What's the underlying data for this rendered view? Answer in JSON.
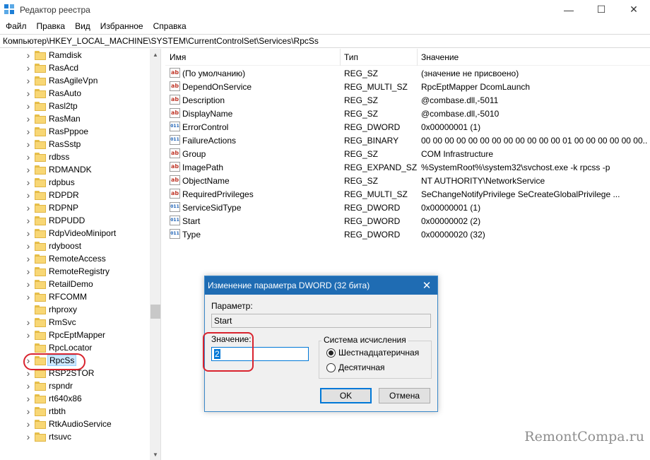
{
  "window": {
    "title": "Редактор реестра",
    "controls": {
      "minimize": "—",
      "maximize": "☐",
      "close": "✕"
    }
  },
  "menu": [
    "Файл",
    "Правка",
    "Вид",
    "Избранное",
    "Справка"
  ],
  "address": "Компьютер\\HKEY_LOCAL_MACHINE\\SYSTEM\\CurrentControlSet\\Services\\RpcSs",
  "tree": {
    "items": [
      {
        "label": "Ramdisk",
        "expandable": true
      },
      {
        "label": "RasAcd",
        "expandable": true
      },
      {
        "label": "RasAgileVpn",
        "expandable": true
      },
      {
        "label": "RasAuto",
        "expandable": true
      },
      {
        "label": "Rasl2tp",
        "expandable": true
      },
      {
        "label": "RasMan",
        "expandable": true
      },
      {
        "label": "RasPppoe",
        "expandable": true
      },
      {
        "label": "RasSstp",
        "expandable": true
      },
      {
        "label": "rdbss",
        "expandable": true
      },
      {
        "label": "RDMANDK",
        "expandable": true
      },
      {
        "label": "rdpbus",
        "expandable": true
      },
      {
        "label": "RDPDR",
        "expandable": true
      },
      {
        "label": "RDPNP",
        "expandable": true
      },
      {
        "label": "RDPUDD",
        "expandable": true
      },
      {
        "label": "RdpVideoMiniport",
        "expandable": true
      },
      {
        "label": "rdyboost",
        "expandable": true
      },
      {
        "label": "RemoteAccess",
        "expandable": true
      },
      {
        "label": "RemoteRegistry",
        "expandable": true
      },
      {
        "label": "RetailDemo",
        "expandable": true
      },
      {
        "label": "RFCOMM",
        "expandable": true
      },
      {
        "label": "rhproxy",
        "expandable": false
      },
      {
        "label": "RmSvc",
        "expandable": true
      },
      {
        "label": "RpcEptMapper",
        "expandable": true
      },
      {
        "label": "RpcLocator",
        "expandable": false
      },
      {
        "label": "RpcSs",
        "expandable": true,
        "selected": true
      },
      {
        "label": "RSP2STOR",
        "expandable": true
      },
      {
        "label": "rspndr",
        "expandable": true
      },
      {
        "label": "rt640x86",
        "expandable": true
      },
      {
        "label": "rtbth",
        "expandable": true
      },
      {
        "label": "RtkAudioService",
        "expandable": true
      },
      {
        "label": "rtsuvc",
        "expandable": true
      }
    ]
  },
  "list": {
    "columns": [
      "Имя",
      "Тип",
      "Значение"
    ],
    "rows": [
      {
        "name": "(По умолчанию)",
        "type": "REG_SZ",
        "value": "(значение не присвоено)",
        "icon": "string-value-icon"
      },
      {
        "name": "DependOnService",
        "type": "REG_MULTI_SZ",
        "value": "RpcEptMapper DcomLaunch",
        "icon": "string-value-icon"
      },
      {
        "name": "Description",
        "type": "REG_SZ",
        "value": "@combase.dll,-5011",
        "icon": "string-value-icon"
      },
      {
        "name": "DisplayName",
        "type": "REG_SZ",
        "value": "@combase.dll,-5010",
        "icon": "string-value-icon"
      },
      {
        "name": "ErrorControl",
        "type": "REG_DWORD",
        "value": "0x00000001 (1)",
        "icon": "binary-value-icon"
      },
      {
        "name": "FailureActions",
        "type": "REG_BINARY",
        "value": "00 00 00 00 00 00 00 00 00 00 00 00 01 00 00 00 00 00 00...",
        "icon": "binary-value-icon"
      },
      {
        "name": "Group",
        "type": "REG_SZ",
        "value": "COM Infrastructure",
        "icon": "string-value-icon"
      },
      {
        "name": "ImagePath",
        "type": "REG_EXPAND_SZ",
        "value": "%SystemRoot%\\system32\\svchost.exe -k rpcss -p",
        "icon": "string-value-icon"
      },
      {
        "name": "ObjectName",
        "type": "REG_SZ",
        "value": "NT AUTHORITY\\NetworkService",
        "icon": "string-value-icon"
      },
      {
        "name": "RequiredPrivileges",
        "type": "REG_MULTI_SZ",
        "value": "SeChangeNotifyPrivilege SeCreateGlobalPrivilege ...",
        "icon": "string-value-icon"
      },
      {
        "name": "ServiceSidType",
        "type": "REG_DWORD",
        "value": "0x00000001 (1)",
        "icon": "binary-value-icon"
      },
      {
        "name": "Start",
        "type": "REG_DWORD",
        "value": "0x00000002 (2)",
        "icon": "binary-value-icon"
      },
      {
        "name": "Type",
        "type": "REG_DWORD",
        "value": "0x00000020 (32)",
        "icon": "binary-value-icon"
      }
    ]
  },
  "dialog": {
    "title": "Изменение параметра DWORD (32 бита)",
    "param_label": "Параметр:",
    "param_value": "Start",
    "value_label": "Значение:",
    "value": "2",
    "base_group": "Система исчисления",
    "radio_hex": "Шестнадцатеричная",
    "radio_dec": "Десятичная",
    "selected_base": "hex",
    "ok": "OK",
    "cancel": "Отмена"
  },
  "watermark": "RemontCompa.ru",
  "colors": {
    "highlight": "#d9232e",
    "dialog_title": "#1f6cb3",
    "selection": "#cce8ff"
  }
}
